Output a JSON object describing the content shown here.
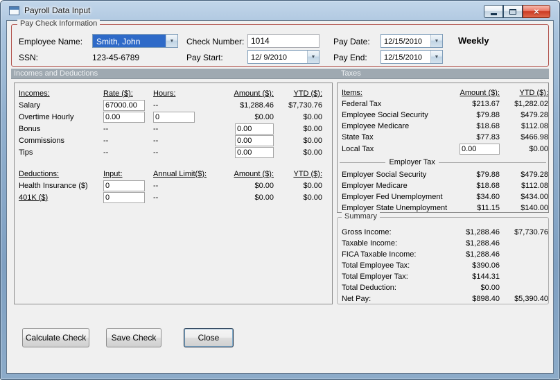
{
  "colors": {
    "paycheck_group_border": "#b0504a",
    "section_header_bg": "#9fa9b1",
    "selection_blue": "#2e6ac8",
    "close_button_red": "#cc3a23",
    "client_bg": "#f0f0f0"
  },
  "glyphs": {
    "dropdown": "▼",
    "close": "×"
  },
  "window": {
    "title": "Payroll Data Input"
  },
  "paycheck": {
    "legend": "Pay Check Information",
    "employee_name": {
      "label": "Employee Name:",
      "value": "Smith, John"
    },
    "ssn": {
      "label": "SSN:",
      "value": "123-45-6789"
    },
    "check_number": {
      "label": "Check Number:",
      "value": "1014"
    },
    "pay_start": {
      "label": "Pay Start:",
      "value": "12/ 9/2010"
    },
    "pay_date": {
      "label": "Pay Date:",
      "value": "12/15/2010"
    },
    "pay_end": {
      "label": "Pay End:",
      "value": "12/15/2010"
    },
    "frequency": "Weekly"
  },
  "section_headers": {
    "incomes_deductions": "Incomes and Deductions",
    "taxes": "Taxes"
  },
  "incomes": {
    "col_label": "Incomes:",
    "col_rate": "Rate ($):",
    "col_hours": "Hours:",
    "col_amount": "Amount ($):",
    "col_ytd": "YTD ($):",
    "salary": {
      "label": "Salary",
      "rate": "67000.00",
      "hours": "--",
      "amount": "$1,288.46",
      "ytd": "$7,730.76"
    },
    "overtime": {
      "label": "Overtime Hourly",
      "rate": "0.00",
      "hours": "0",
      "amount": "$0.00",
      "ytd": "$0.00"
    },
    "bonus": {
      "label": "Bonus",
      "rate": "--",
      "hours": "--",
      "amount": "0.00",
      "ytd": "$0.00"
    },
    "commissions": {
      "label": "Commissions",
      "rate": "--",
      "hours": "--",
      "amount": "0.00",
      "ytd": "$0.00"
    },
    "tips": {
      "label": "Tips",
      "rate": "--",
      "hours": "--",
      "amount": "0.00",
      "ytd": "$0.00"
    }
  },
  "deductions": {
    "col_label": "Deductions:",
    "col_input": "Input:",
    "col_limit": "Annual Limit($):",
    "col_amount": "Amount ($):",
    "col_ytd": "YTD ($):",
    "health": {
      "label": "Health Insurance  ($)",
      "input": "0",
      "limit": "--",
      "amount": "$0.00",
      "ytd": "$0.00"
    },
    "k401": {
      "label": "401K  ($)",
      "input": "0",
      "limit": "--",
      "amount": "$0.00",
      "ytd": "$0.00"
    }
  },
  "taxes": {
    "col_items": "Items:",
    "col_amount": "Amount ($):",
    "col_ytd": "YTD ($):",
    "federal": {
      "label": "Federal Tax",
      "amount": "$213.67",
      "ytd": "$1,282.02"
    },
    "emp_ss": {
      "label": "Employee Social Security",
      "amount": "$79.88",
      "ytd": "$479.28"
    },
    "emp_medicare": {
      "label": "Employee Medicare",
      "amount": "$18.68",
      "ytd": "$112.08"
    },
    "state": {
      "label": "State Tax",
      "amount": "$77.83",
      "ytd": "$466.98"
    },
    "local": {
      "label": "Local Tax",
      "amount": "0.00",
      "ytd": "$0.00"
    },
    "employer_group": "Employer Tax",
    "er_ss": {
      "label": "Employer Social Security",
      "amount": "$79.88",
      "ytd": "$479.28"
    },
    "er_medicare": {
      "label": "Employer Medicare",
      "amount": "$18.68",
      "ytd": "$112.08"
    },
    "er_fed_unemp": {
      "label": "Employer Fed Unemployment",
      "amount": "$34.60",
      "ytd": "$434.00"
    },
    "er_state_unemp": {
      "label": "Employer State Unemployment",
      "amount": "$11.15",
      "ytd": "$140.00"
    }
  },
  "summary": {
    "legend": "Summary",
    "gross": {
      "label": "Gross Income:",
      "amount": "$1,288.46",
      "ytd": "$7,730.76"
    },
    "taxable": {
      "label": "Taxable Income:",
      "amount": "$1,288.46",
      "ytd": ""
    },
    "fica": {
      "label": "FICA Taxable Income:",
      "amount": "$1,288.46",
      "ytd": ""
    },
    "total_employee_tax": {
      "label": "Total Employee Tax:",
      "amount": "$390.06",
      "ytd": ""
    },
    "total_employer_tax": {
      "label": "Total Employer Tax:",
      "amount": "$144.31",
      "ytd": ""
    },
    "total_deduction": {
      "label": "Total Deduction:",
      "amount": "$0.00",
      "ytd": ""
    },
    "net_pay": {
      "label": "Net Pay:",
      "amount": "$898.40",
      "ytd": "$5,390.40"
    }
  },
  "buttons": {
    "calculate": "Calculate Check",
    "save": "Save Check",
    "close": "Close"
  }
}
